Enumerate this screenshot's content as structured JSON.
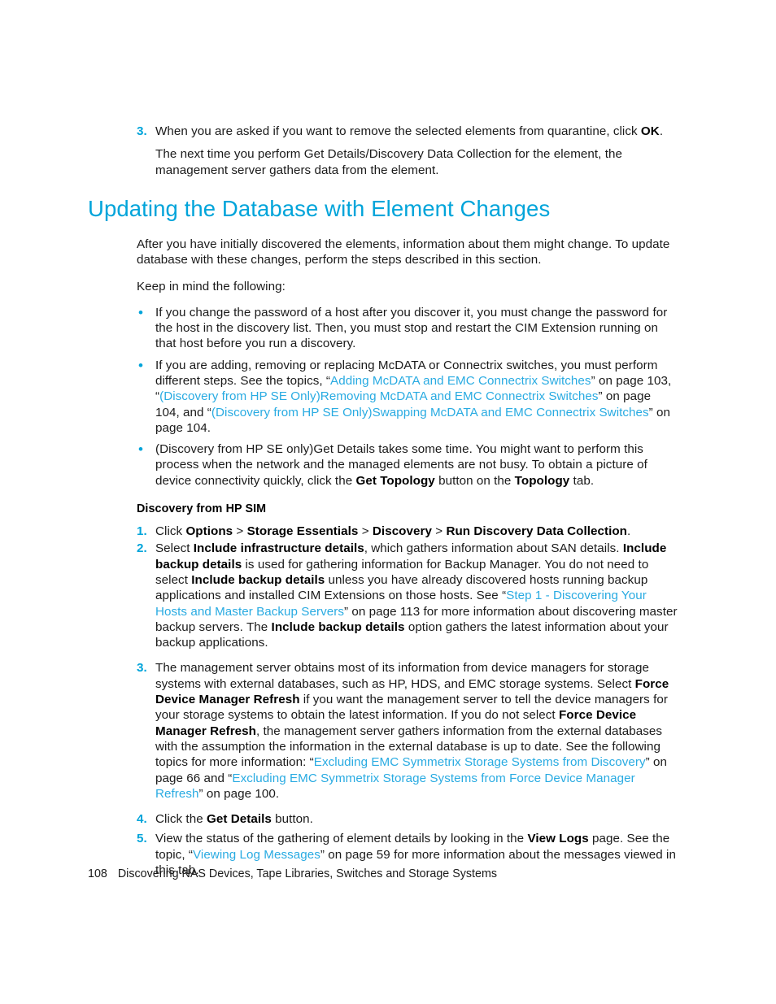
{
  "page": {
    "number": "108",
    "footer_title": "Discovering NAS Devices, Tape Libraries, Switches and Storage Systems",
    "accent_color": "#00a4da",
    "link_color": "#29abe2",
    "text_color": "#1a1a1a",
    "background_color": "#ffffff"
  },
  "top_list": {
    "item3": {
      "marker": "3.",
      "line1_pre": "When you are asked if you want to remove the selected elements from quarantine, click ",
      "line1_bold": "OK",
      "line1_post": ".",
      "continuation": "The next time you perform Get Details/Discovery Data Collection for the element, the management server gathers data from the element."
    }
  },
  "heading": {
    "title": "Updating the Database with Element Changes"
  },
  "intro": {
    "paragraph1": "After you have initially discovered the elements, information about them might change. To update database with these changes, perform the steps described in this section.",
    "paragraph2": "Keep in mind the following:"
  },
  "bullets": [
    {
      "marker": "•",
      "text": "If you change the password of a host after you discover it, you must change the password for the host in the discovery list. Then, you must stop and restart the CIM Extension running on that host before you run a discovery."
    },
    {
      "marker": "•",
      "seg1": "If you are adding, removing or replacing McDATA or Connectrix switches, you must perform different steps. See the topics, “",
      "link1": "Adding McDATA and EMC Connectrix Switches",
      "seg2": "” on page 103, “",
      "link2": "(Discovery from HP SE Only)Removing McDATA and EMC Connectrix Switches",
      "seg3": "” on page 104, and “",
      "link3": "(Discovery from HP SE Only)Swapping McDATA and EMC Connectrix Switches",
      "seg4": "” on page 104."
    },
    {
      "marker": "•",
      "seg1": "(Discovery from HP SE only)Get Details takes some time. You might want to perform this process when the network and the managed elements are not busy. To obtain a picture of device connectivity quickly, click the ",
      "bold1": "Get Topology",
      "seg2": " button on the ",
      "bold2": "Topology",
      "seg3": " tab."
    }
  ],
  "subsection": {
    "heading": "Discovery from HP SIM",
    "steps": [
      {
        "marker": "1.",
        "seg1": "Click ",
        "bold1": "Options",
        "seg2": " > ",
        "bold2": "Storage Essentials",
        "seg3": " > ",
        "bold3": "Discovery",
        "seg4": " > ",
        "bold4": "Run Discovery Data Collection",
        "seg5": "."
      },
      {
        "marker": "2.",
        "seg1": "Select ",
        "bold1": "Include infrastructure details",
        "seg2": ", which gathers information about SAN details. ",
        "bold2": "Include backup details",
        "seg3": " is used for gathering information for Backup Manager. You do not need to select ",
        "bold3": "Include backup details",
        "seg4": " unless you have already discovered hosts running backup applications and installed CIM Extensions on those hosts. See “",
        "link1": "Step 1 - Discovering Your Hosts and Master Backup Servers",
        "seg5": "” on page 113 for more information about discovering master backup servers. The ",
        "bold4": "Include backup details",
        "seg6": " option gathers the latest information about your backup applications."
      },
      {
        "marker": "3.",
        "seg1": "The management server obtains most of its information from device managers for storage systems with external databases, such as HP, HDS, and EMC storage systems. Select ",
        "bold1": "Force Device Manager Refresh",
        "seg2": " if you want the management server to tell the device managers for your storage systems to obtain the latest information. If you do not select ",
        "bold2": "Force Device Manager Refresh",
        "seg3": ", the management server gathers information from the external databases with the assumption the information in the external database is up to date. See the following topics for more information: “",
        "link1": "Excluding EMC Symmetrix Storage Systems from Discovery",
        "seg4": "” on page 66 and “",
        "link2": "Excluding EMC Symmetrix Storage Systems from Force Device Manager Refresh",
        "seg5": "” on page 100."
      },
      {
        "marker": "4.",
        "seg1": "Click the ",
        "bold1": "Get Details",
        "seg2": " button."
      },
      {
        "marker": "5.",
        "seg1": "View the status of the gathering of element details by looking in the ",
        "bold1": "View Logs",
        "seg2": " page. See the topic, “",
        "link1": "Viewing Log Messages",
        "seg3": "” on page 59 for more information about the messages viewed in this tab."
      }
    ]
  }
}
